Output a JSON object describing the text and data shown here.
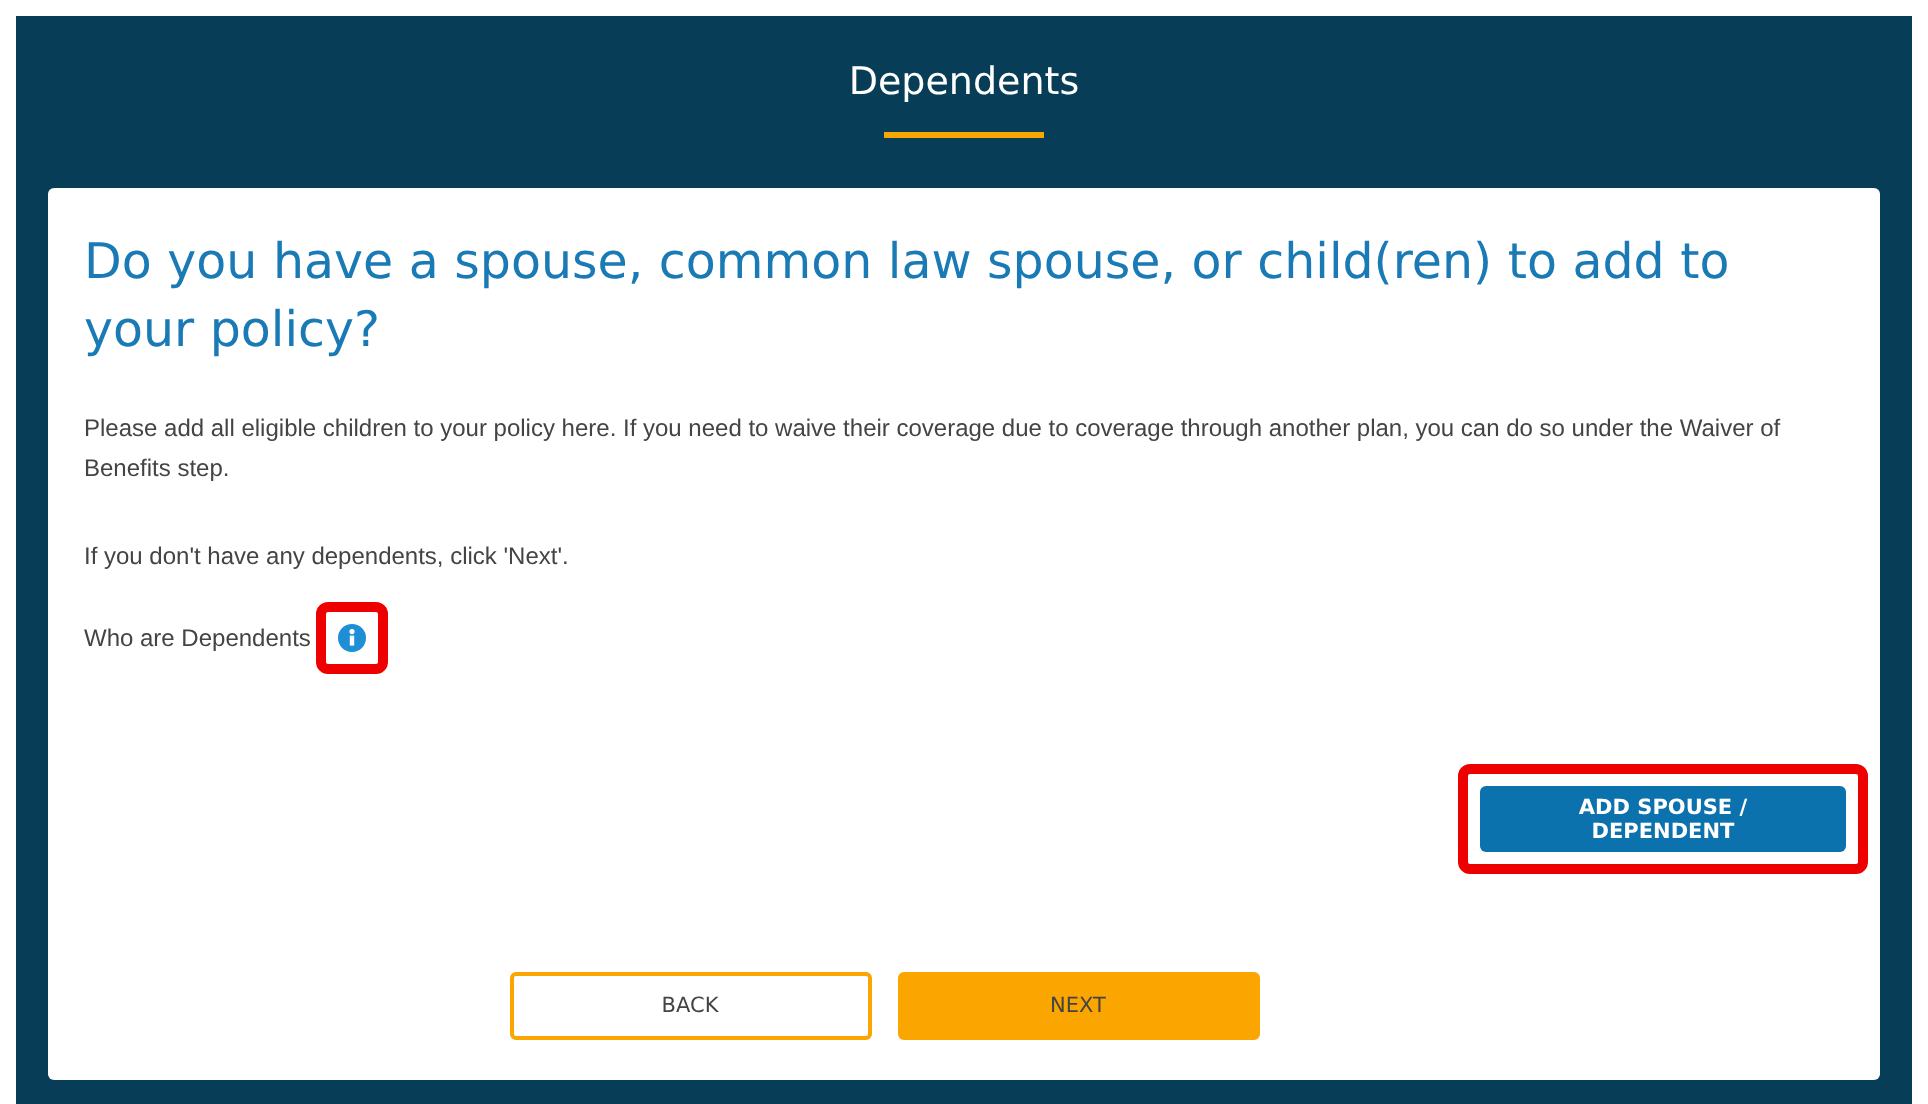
{
  "header": {
    "title": "Dependents"
  },
  "question": "Do you have a spouse, common law spouse, or child(ren) to add to your policy?",
  "paragraphs": [
    "Please add all eligible children to your policy here. If you need to waive their coverage due to coverage through another plan, you can do so under the Waiver of Benefits step.",
    "If you don't have any dependents, click 'Next'."
  ],
  "info": {
    "label": "Who are Dependents",
    "highlighted": true
  },
  "add_button": {
    "label": "ADD SPOUSE / DEPENDENT",
    "highlighted": true
  },
  "nav_buttons": [
    {
      "label": "BACK",
      "kind": "outline"
    },
    {
      "label": "NEXT",
      "kind": "filled"
    }
  ]
}
